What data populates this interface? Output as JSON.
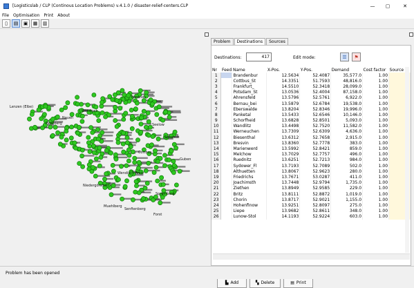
{
  "window": {
    "title": "[Logisticslab / CLP (Continous Location Problems) v.4.1.0 / disaster-relief-centers.CLP",
    "minimize": "—",
    "maximize": "▢",
    "close": "✕"
  },
  "menu": [
    "File",
    "Optimisation",
    "Print",
    "About"
  ],
  "toolbar": {
    "buttons": [
      "new-icon",
      "open-icon",
      "save-icon",
      "save-as-icon",
      "print-icon"
    ]
  },
  "colors": {
    "nodes": "#2ec820",
    "node_border": "#0e6a08",
    "source_cell": "#fff8dc",
    "selected": "#c8d6ef"
  },
  "tabs": [
    "Problem",
    "Destinations",
    "Sources"
  ],
  "destinations": {
    "label": "Destinations:",
    "count": "417"
  },
  "edit_mode": {
    "label": "Edit mode:"
  },
  "table": {
    "headers": [
      "Nr",
      "Feed",
      "Name",
      "X-Pos.",
      "Y-Pos.",
      "Demand",
      "Cost factor",
      "Source"
    ],
    "rows": [
      [
        "1",
        "",
        "Brandenbur",
        "12.5634",
        "52.4087",
        "35,577.0",
        "1.00",
        ""
      ],
      [
        "2",
        "",
        "Cottbus_St",
        "14.3351",
        "51.7593",
        "48,816.0",
        "1.00",
        ""
      ],
      [
        "3",
        "",
        "Frankfurt_",
        "14.5510",
        "52.3418",
        "28,099.0",
        "1.00",
        ""
      ],
      [
        "4",
        "",
        "Potsdam_St",
        "13.0536",
        "52.4004",
        "87,158.0",
        "1.00",
        ""
      ],
      [
        "5",
        "",
        "Ahrensfeld",
        "13.5796",
        "52.5761",
        "6,922.0",
        "1.00",
        ""
      ],
      [
        "6",
        "",
        "Bernau_bei",
        "13.5879",
        "52.6784",
        "19,538.0",
        "1.00",
        ""
      ],
      [
        "7",
        "",
        "Eberswalde",
        "13.8204",
        "52.8346",
        "19,996.0",
        "1.00",
        ""
      ],
      [
        "8",
        "",
        "Panketal",
        "13.5433",
        "52.6546",
        "10,146.0",
        "1.00",
        ""
      ],
      [
        "9",
        "",
        "Schorfheid",
        "13.6828",
        "52.8501",
        "5,093.0",
        "1.00",
        ""
      ],
      [
        "10",
        "",
        "Wandlitz",
        "13.4498",
        "52.7520",
        "11,582.0",
        "1.00",
        ""
      ],
      [
        "11",
        "",
        "Werneuchen",
        "13.7309",
        "52.6309",
        "4,636.0",
        "1.00",
        ""
      ],
      [
        "12",
        "",
        "Biesenthal",
        "13.6312",
        "52.7658",
        "2,915.0",
        "1.00",
        ""
      ],
      [
        "13",
        "",
        "Bresvin",
        "13.8360",
        "52.7778",
        "383.0",
        "1.00",
        ""
      ],
      [
        "14",
        "",
        "Marienwerd",
        "13.5992",
        "52.8421",
        "859.0",
        "1.00",
        ""
      ],
      [
        "15",
        "",
        "Melchow",
        "13.7029",
        "52.7757",
        "496.0",
        "1.00",
        ""
      ],
      [
        "16",
        "",
        "Ruednitz",
        "13.6251",
        "52.7213",
        "984.0",
        "1.00",
        ""
      ],
      [
        "17",
        "",
        "Sydower_Fl",
        "13.7193",
        "52.7089",
        "502.0",
        "1.00",
        ""
      ],
      [
        "18",
        "",
        "Althuetten",
        "13.8067",
        "52.9623",
        "280.0",
        "1.00",
        ""
      ],
      [
        "19",
        "",
        "Friedrichs",
        "13.7671",
        "53.0287",
        "411.0",
        "1.00",
        ""
      ],
      [
        "20",
        "",
        "Joachimsth",
        "13.7448",
        "52.9794",
        "1,735.0",
        "1.00",
        ""
      ],
      [
        "21",
        "",
        "Ziethen",
        "13.8949",
        "52.9585",
        "229.0",
        "1.00",
        ""
      ],
      [
        "22",
        "",
        "Britz",
        "13.8111",
        "52.8872",
        "1,019.0",
        "1.00",
        ""
      ],
      [
        "23",
        "",
        "Chorin",
        "13.8717",
        "52.9021",
        "1,155.0",
        "1.00",
        ""
      ],
      [
        "24",
        "",
        "Hohenfinow",
        "13.9251",
        "52.8097",
        "275.0",
        "1.00",
        ""
      ],
      [
        "25",
        "",
        "Liepe",
        "13.9682",
        "52.8611",
        "348.0",
        "1.00",
        ""
      ],
      [
        "26",
        "",
        "Lunow-Stol",
        "14.1193",
        "52.9224",
        "603.0",
        "1.00",
        ""
      ]
    ]
  },
  "buttons": {
    "add": "Add",
    "delete": "Delete",
    "print": "Print"
  },
  "map": {
    "labels": [
      "Lenzen (Elbe)",
      "Nauen",
      "Wendisch Rietz",
      "Niedergörsdorf",
      "Muehlberg",
      "Seelow",
      "Spremberg",
      "Schwedt",
      "Forst",
      "Guben",
      "Senftenberg",
      "Cottbus",
      "Wittstock",
      "Prenzlau",
      "Perleberg"
    ]
  },
  "status": "Problem has been opened"
}
